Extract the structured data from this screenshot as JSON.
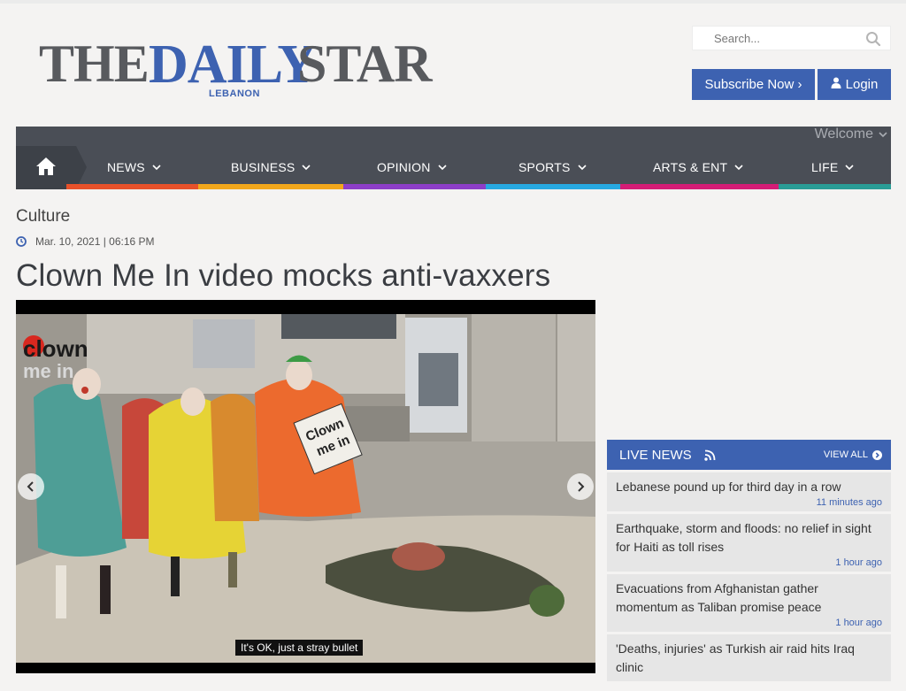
{
  "brand": {
    "the": "THE",
    "daily": "DAILY",
    "star": "STAR",
    "sub": "LEBANON",
    "colors": {
      "blue": "#3d62b1",
      "gray": "#585a5e"
    }
  },
  "search": {
    "placeholder": "Search...",
    "icon": "search-icon"
  },
  "account": {
    "subscribe": "Subscribe Now ›",
    "login": "Login"
  },
  "nav": {
    "welcome": "Welcome",
    "home_icon": "home-icon",
    "items": [
      {
        "label": "NEWS",
        "color": "#e8512a"
      },
      {
        "label": "BUSINESS",
        "color": "#f2a71b"
      },
      {
        "label": "OPINION",
        "color": "#8e3ec9"
      },
      {
        "label": "SPORTS",
        "color": "#27a9e1"
      },
      {
        "label": "ARTS & ENT",
        "color": "#d51c76"
      },
      {
        "label": "LIFE",
        "color": "#2a9d96"
      }
    ]
  },
  "article": {
    "section": "Culture",
    "date": "Mar. 10, 2021 | 06:16 PM",
    "headline": "Clown Me In video mocks anti-vaxxers",
    "media": {
      "caption": "It's OK, just a stray bullet",
      "watermark_top": "clown",
      "watermark_bottom": "me in",
      "sign_line1": "Clown",
      "sign_line2": "me in"
    }
  },
  "live_news": {
    "title": "LIVE NEWS",
    "view_all": "VIEW ALL",
    "items": [
      {
        "title": "Lebanese pound up for third day in a row",
        "time": "11 minutes ago"
      },
      {
        "title": "Earthquake, storm and floods: no relief in sight for Haiti as toll rises",
        "time": "1 hour ago"
      },
      {
        "title": "Evacuations from Afghanistan gather momentum as Taliban promise peace",
        "time": "1 hour ago"
      },
      {
        "title": "'Deaths, injuries' as Turkish air raid hits Iraq clinic",
        "time": ""
      }
    ]
  }
}
